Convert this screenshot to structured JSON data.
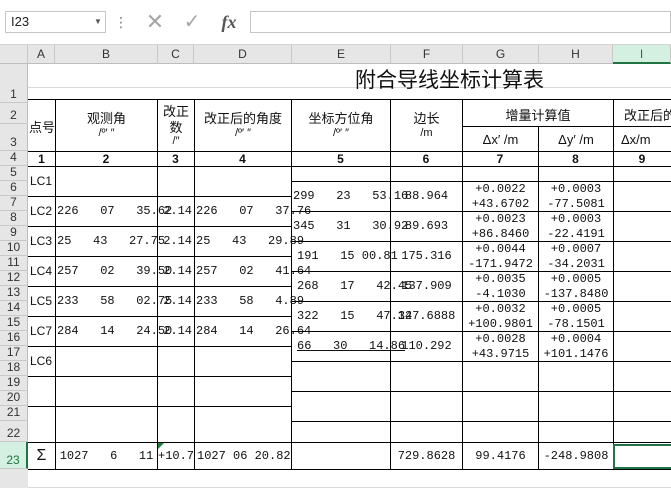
{
  "formula_bar": {
    "name_box": "I23",
    "more_icon": "⋮",
    "cancel_icon": "✕",
    "enter_icon": "✓",
    "fx_label": "fx",
    "formula": ""
  },
  "columns": [
    "A",
    "B",
    "C",
    "D",
    "E",
    "F",
    "G",
    "H",
    "I"
  ],
  "rows": [
    "1",
    "2",
    "3",
    "4",
    "5",
    "6",
    "7",
    "8",
    "9",
    "10",
    "11",
    "12",
    "13",
    "14",
    "15",
    "16",
    "17",
    "18",
    "19",
    "20",
    "21",
    "22",
    "23"
  ],
  "sheet": {
    "title": "附合导线坐标计算表",
    "headers": {
      "point": "点号",
      "obs_angle": "观测角",
      "obs_angle_unit": "/º′ ″",
      "correction_1": "改正",
      "correction_2": "数",
      "correction_unit": "/″",
      "corrected_angle": "改正后的角度",
      "corrected_angle_unit": "/º′ ″",
      "azimuth": "坐标方位角",
      "azimuth_unit": "/º′ ″",
      "side_length": "边长",
      "side_length_unit": "/m",
      "increment": "增量计算值",
      "dx_header": "Δx′ /m",
      "dy_header": "Δy′ /m",
      "corrected_partial": "改正后的",
      "dx_corrected": "Δx/m"
    },
    "col_numbers": [
      "1",
      "2",
      "3",
      "4",
      "5",
      "6",
      "7",
      "8",
      "9"
    ],
    "stations": [
      {
        "name": "LC1",
        "obs": "",
        "corr": "",
        "corrected": ""
      },
      {
        "name": "LC2",
        "obs": "226   07   35.62",
        "corr": "2.14",
        "corrected": "226   07   37.76"
      },
      {
        "name": "LC3",
        "obs": "25   43   27.75",
        "corr": "2.14",
        "corrected": "25   43   29.89"
      },
      {
        "name": "LC4",
        "obs": "257   02   39.50",
        "corr": "2.14",
        "corrected": "257   02   41.64"
      },
      {
        "name": "LC5",
        "obs": "233   58   02.75",
        "corr": "2.14",
        "corrected": "233   58   4.89"
      },
      {
        "name": "LC7",
        "obs": "284   14   24.50",
        "corr": "2.14",
        "corrected": "284   14   26.64"
      },
      {
        "name": "LC6",
        "obs": "",
        "corr": "",
        "corrected": ""
      }
    ],
    "legs": [
      {
        "azimuth": "299   23   53.16",
        "length": "88.964",
        "dx_corr": "+0.0022",
        "dx": "+43.6702",
        "dy_corr": "+0.0003",
        "dy": "-77.5081"
      },
      {
        "azimuth": "345   31   30.92",
        "length": "89.693",
        "dx_corr": "+0.0023",
        "dx": "+86.8460",
        "dy_corr": "+0.0003",
        "dy": "-22.4191"
      },
      {
        "azimuth": "191   15 00.81",
        "length": "175.316",
        "dx_corr": "+0.0044",
        "dx": "-171.9472",
        "dy_corr": "+0.0007",
        "dy": "-34.2031"
      },
      {
        "azimuth": "268   17   42.45",
        "length": "137.909",
        "dx_corr": "+0.0035",
        "dx": "-4.1030",
        "dy_corr": "+0.0005",
        "dy": "-137.8480"
      },
      {
        "azimuth": "322   15   47.34",
        "length": "127.6888",
        "dx_corr": "+0.0032",
        "dx": "+100.9801",
        "dy_corr": "+0.0005",
        "dy": "-78.1501"
      },
      {
        "azimuth": "66   30   14.86",
        "length": "110.292",
        "dx_corr": "+0.0028",
        "dx": "+43.9715",
        "dy_corr": "+0.0004",
        "dy": "+101.1476"
      }
    ],
    "sum": {
      "symbol": "Σ",
      "obs": "1027   6   11",
      "corr": "+10.7",
      "corrected": "1027 06 20.82",
      "length": "729.8628",
      "dx": "99.4176",
      "dy": "-248.9808"
    }
  }
}
